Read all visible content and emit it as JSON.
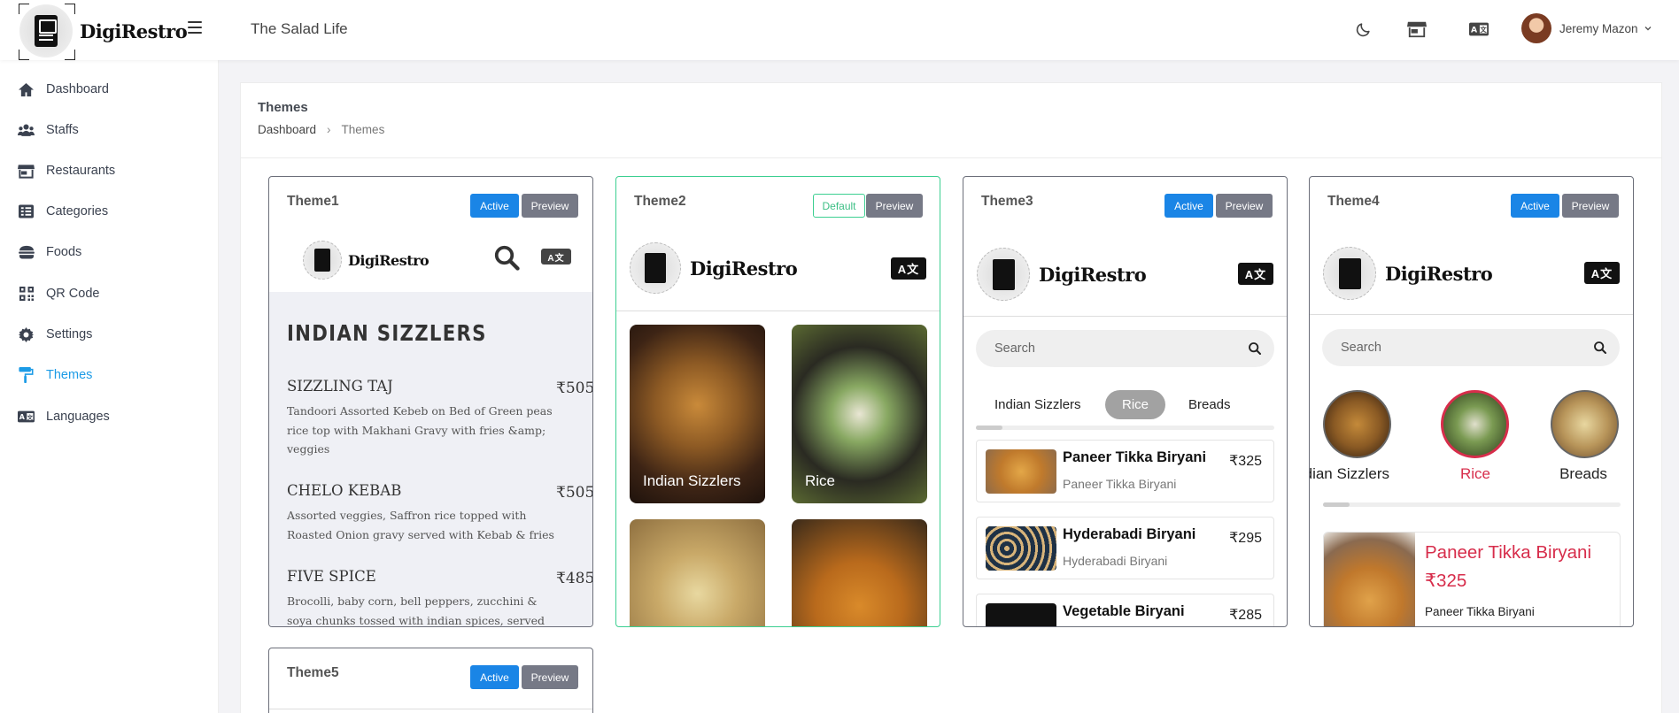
{
  "brand": {
    "name": "DigiRestro"
  },
  "header": {
    "restaurant": "The Salad Life",
    "user_name": "Jeremy Mazon"
  },
  "sidebar": {
    "items": [
      {
        "label": "Dashboard",
        "icon": "home-icon"
      },
      {
        "label": "Staffs",
        "icon": "users-icon"
      },
      {
        "label": "Restaurants",
        "icon": "store-icon"
      },
      {
        "label": "Categories",
        "icon": "list-icon"
      },
      {
        "label": "Foods",
        "icon": "burger-icon"
      },
      {
        "label": "QR Code",
        "icon": "qrcode-icon"
      },
      {
        "label": "Settings",
        "icon": "gear-icon"
      },
      {
        "label": "Themes",
        "icon": "paint-roller-icon",
        "active": true
      },
      {
        "label": "Languages",
        "icon": "language-icon"
      }
    ]
  },
  "page": {
    "title": "Themes",
    "breadcrumb": [
      "Dashboard",
      "Themes"
    ]
  },
  "buttons": {
    "active": "Active",
    "preview": "Preview",
    "default": "Default"
  },
  "themes": {
    "t1": {
      "title": "Theme1",
      "category": "INDIAN SIZZLERS",
      "items": [
        {
          "name": "SIZZLING TAJ",
          "price": "₹505",
          "desc": "Tandoori Assorted Kebeb on Bed of Green peas rice top with Makhani Gravy with fries &amp; veggies"
        },
        {
          "name": "CHELO KEBAB",
          "price": "₹505",
          "desc": "Assorted veggies, Saffron rice topped with Roasted Onion gravy served with Kebab & fries"
        },
        {
          "name": "FIVE SPICE",
          "price": "₹485",
          "desc": "Brocolli, baby corn, bell peppers, zucchini & soya chunks tossed with indian spices, served"
        }
      ]
    },
    "t2": {
      "title": "Theme2",
      "tiles": [
        "Indian Sizzlers",
        "Rice"
      ]
    },
    "t3": {
      "title": "Theme3",
      "search_placeholder": "Search",
      "tabs": [
        "Indian Sizzlers",
        "Rice",
        "Breads"
      ],
      "items": [
        {
          "name": "Paneer Tikka Biryani",
          "sub": "Paneer Tikka Biryani",
          "price": "₹325"
        },
        {
          "name": "Hyderabadi Biryani",
          "sub": "Hyderabadi Biryani",
          "price": "₹295"
        },
        {
          "name": "Vegetable Biryani",
          "sub": "",
          "price": "₹285"
        }
      ]
    },
    "t4": {
      "title": "Theme4",
      "search_placeholder": "Search",
      "categories": [
        "idian Sizzlers",
        "Rice",
        "Breads"
      ],
      "item": {
        "name": "Paneer Tikka Biryani",
        "price": "₹325",
        "sub": "Paneer Tikka Biryani"
      }
    },
    "t5": {
      "title": "Theme5"
    }
  },
  "colors": {
    "accent": "#1c9be6",
    "active_btn": "#1a85e6",
    "preview_btn": "#767986",
    "default_border": "#3ccf91",
    "t4_highlight": "#d72d4b"
  }
}
